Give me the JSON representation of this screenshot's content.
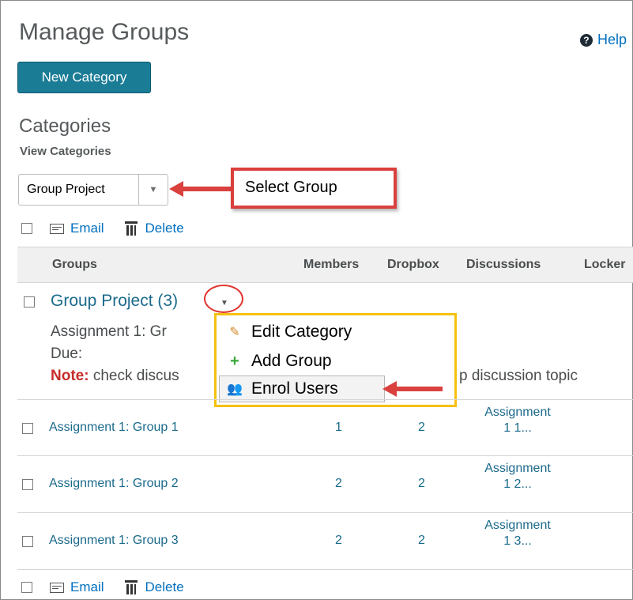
{
  "page": {
    "title": "Manage Groups",
    "help_label": "Help"
  },
  "actions": {
    "new_category": "New Category"
  },
  "categories": {
    "heading": "Categories",
    "view_label": "View Categories",
    "selected": "Group Project"
  },
  "callout": {
    "label": "Select Group"
  },
  "toolbar": {
    "email": "Email",
    "delete": "Delete"
  },
  "table": {
    "headers": [
      "Groups",
      "Members",
      "Dropbox",
      "Discussions",
      "Locker"
    ],
    "category_title": "Group Project (3)",
    "description_line1": "Assignment 1:  Gr",
    "description_line2": "Due:",
    "note_label": "Note:",
    "note_text_start": " check discus",
    "note_text_end": "p discussion topic",
    "rows": [
      {
        "name": "Assignment 1: Group 1",
        "members": "1",
        "dropbox": "2",
        "discussions_1": "Assignment",
        "discussions_2": "1 1..."
      },
      {
        "name": "Assignment 1: Group 2",
        "members": "2",
        "dropbox": "2",
        "discussions_1": "Assignment",
        "discussions_2": "1 2..."
      },
      {
        "name": "Assignment 1: Group 3",
        "members": "2",
        "dropbox": "2",
        "discussions_1": "Assignment",
        "discussions_2": "1 3..."
      }
    ]
  },
  "context_menu": {
    "items": [
      {
        "label": "Edit Category",
        "icon": "pencil-icon"
      },
      {
        "label": "Add Group",
        "icon": "plus-icon"
      },
      {
        "label": "Enrol Users",
        "icon": "users-icon"
      }
    ]
  },
  "colors": {
    "accent": "#1b7c96",
    "link": "#1b6a8c",
    "callout_red": "#d9403e",
    "menu_highlight": "#f5c10e",
    "note_red": "#c62d2a"
  }
}
